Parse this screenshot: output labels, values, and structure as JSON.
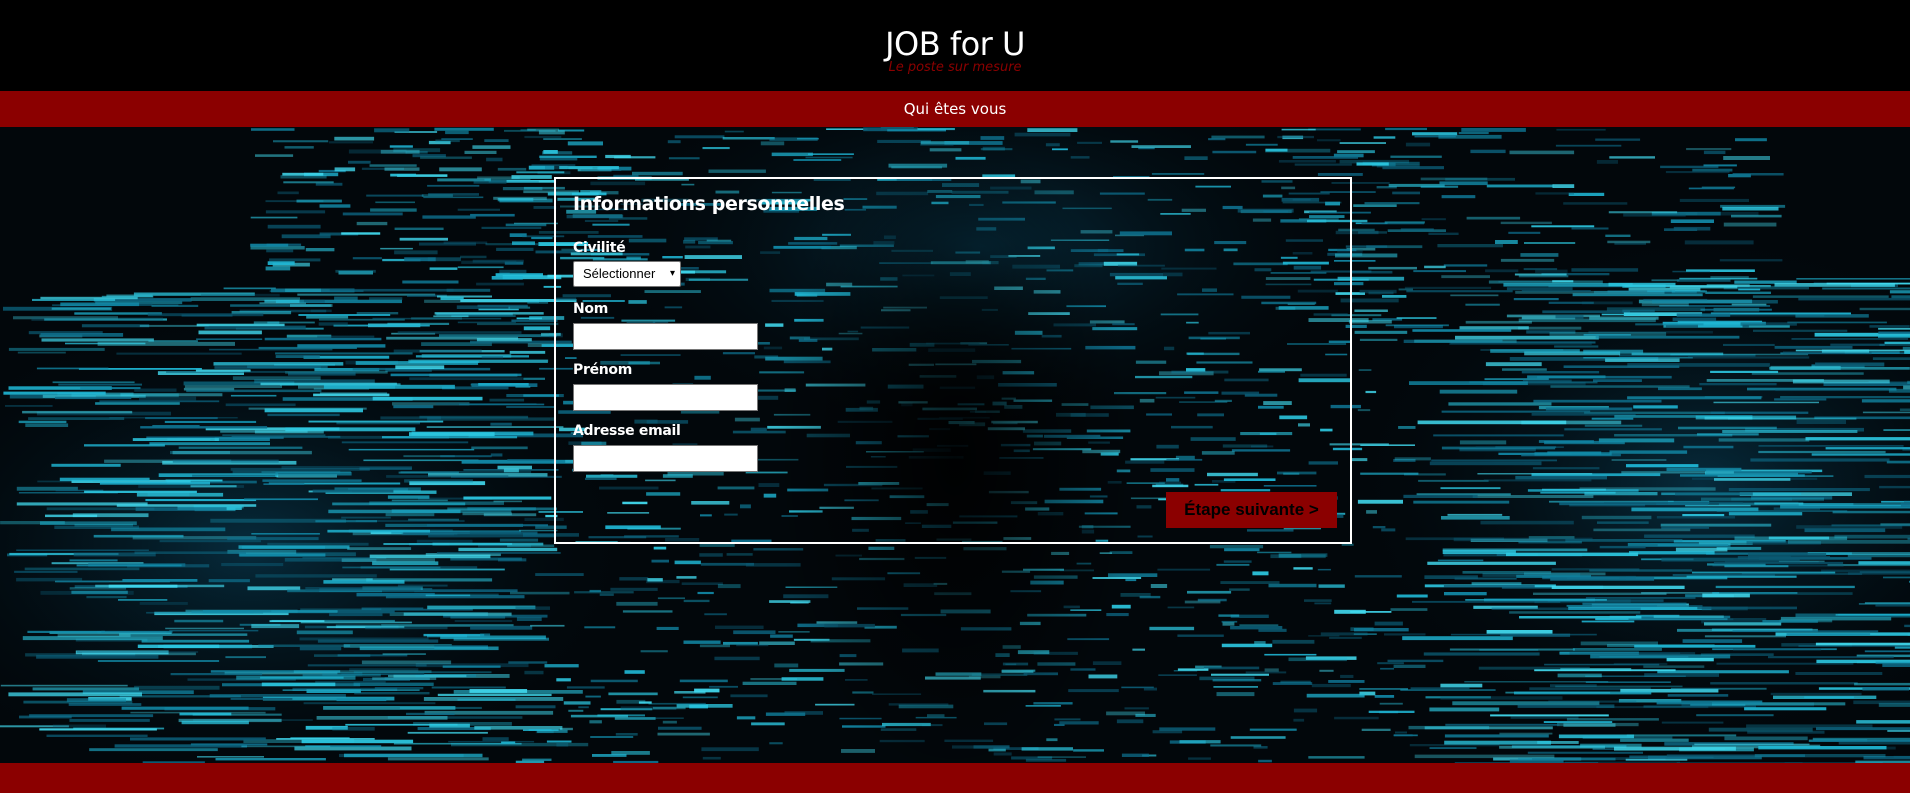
{
  "header": {
    "title": "JOB for U",
    "tagline": "Le poste sur mesure"
  },
  "nav": {
    "items": [
      {
        "label": "Qui êtes vous"
      }
    ]
  },
  "form": {
    "title": "Informations personnelles",
    "civilite": {
      "label": "Civilité",
      "selected": "Sélectionner"
    },
    "nom": {
      "label": "Nom",
      "value": ""
    },
    "prenom": {
      "label": "Prénom",
      "value": ""
    },
    "email": {
      "label": "Adresse email",
      "value": ""
    },
    "next_button": "Étape suivante >"
  },
  "colors": {
    "brand_red": "#8b0000",
    "header_bg": "#000000",
    "text_white": "#ffffff"
  },
  "icons": {
    "select_caret": "chevron-down-icon"
  }
}
